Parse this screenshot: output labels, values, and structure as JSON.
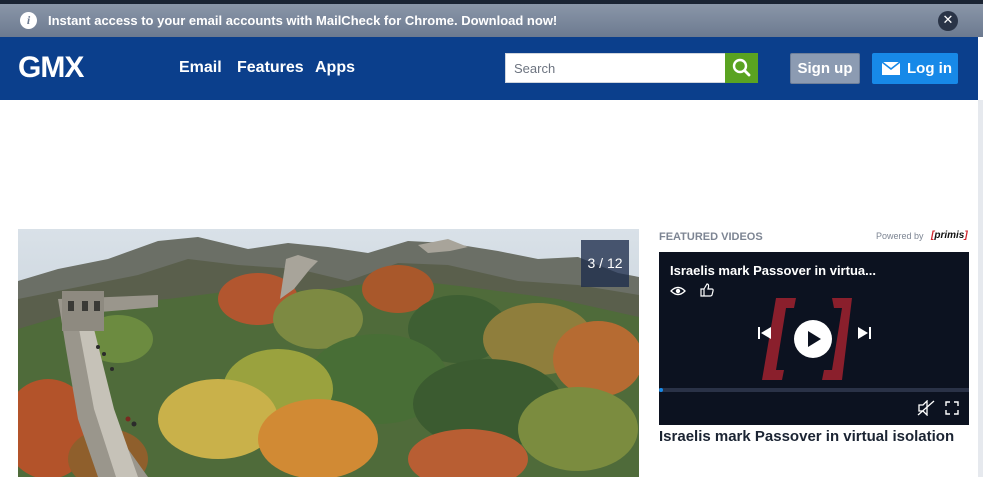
{
  "notice": {
    "info_icon": "info-icon",
    "text": "Instant access to your email accounts with MailCheck for Chrome. Download now!",
    "close_icon": "close-icon"
  },
  "header": {
    "logo": "GMX",
    "nav": [
      {
        "label": "Email"
      },
      {
        "label": "Features"
      },
      {
        "label": "Apps"
      }
    ],
    "search_placeholder": "Search",
    "signup_label": "Sign up",
    "login_label": "Log in"
  },
  "gallery": {
    "counter": "3 / 12"
  },
  "featured": {
    "label": "FEATURED VIDEOS",
    "powered_by": "Powered by",
    "brand": "primis",
    "player_title": "Israelis mark Passover in virtua...",
    "caption": "Israelis mark Passover in virtual isolation"
  },
  "colors": {
    "header_bg": "#0b3f8c",
    "search_button": "#5aa321",
    "login_button": "#1789e8",
    "signup_button": "#8c9bb2",
    "brand_red": "#d0242d"
  }
}
